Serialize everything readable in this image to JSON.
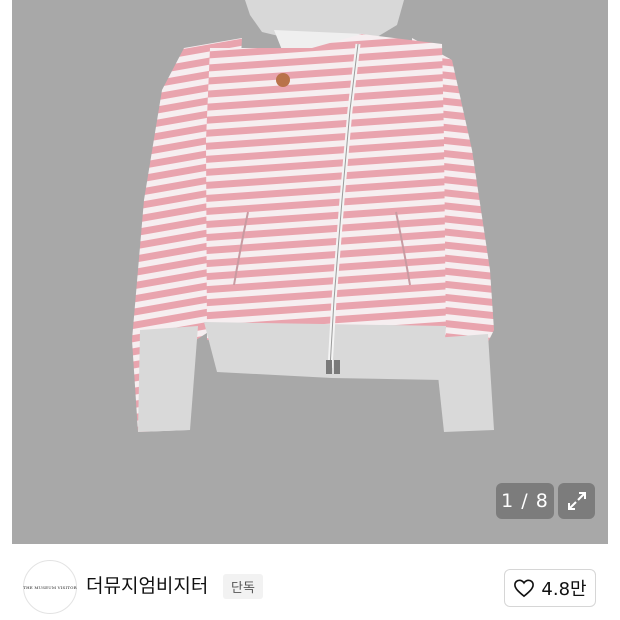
{
  "gallery": {
    "counter": "1 / 8",
    "current_image": 1,
    "total_images": 8,
    "expand_icon": "expand-icon",
    "photo_description_icon": "striped-zip-hoodie-image"
  },
  "shop": {
    "logo_text": "THE MUSEUM VISITOR",
    "name": "더뮤지엄비지터",
    "badge": "단독",
    "like_icon": "heart-icon",
    "like_count": "4.8만"
  },
  "colors": {
    "photo_background": "#a8a8a8",
    "stripe_pink": "#e9a4ae",
    "stripe_white": "#f6eef0",
    "rib_grey": "#d9d9d9"
  }
}
